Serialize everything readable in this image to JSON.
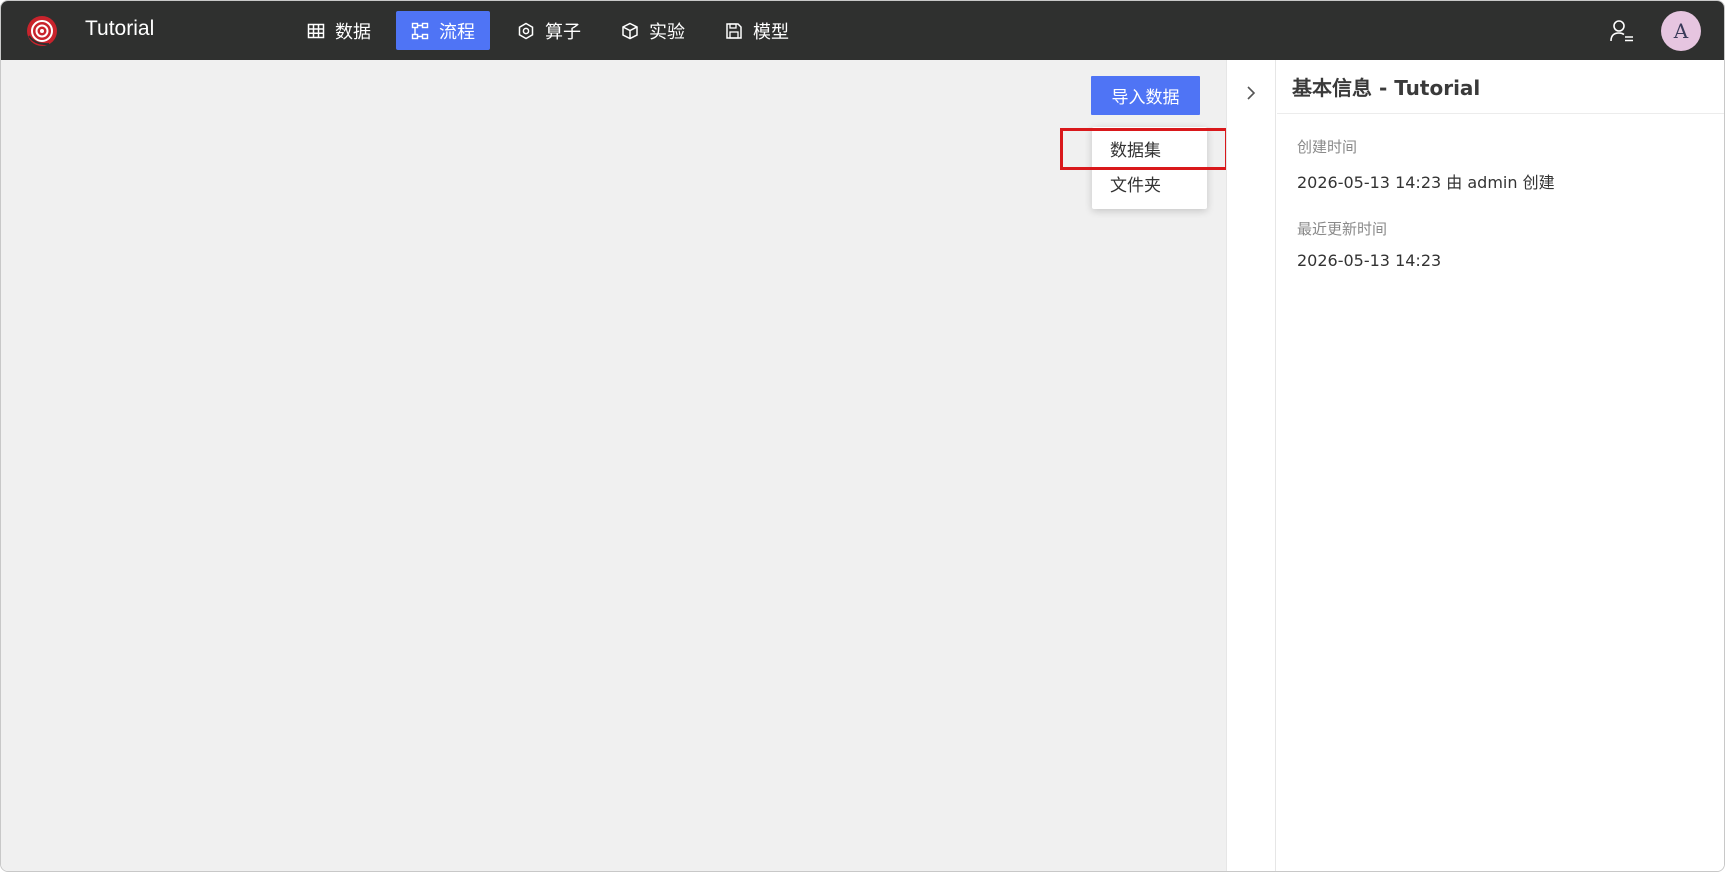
{
  "app": {
    "title": "Tutorial"
  },
  "nav": {
    "tabs": [
      {
        "label": "数据",
        "icon": "table-icon",
        "active": false
      },
      {
        "label": "流程",
        "icon": "flow-icon",
        "active": true
      },
      {
        "label": "算子",
        "icon": "hexagon-icon",
        "active": false
      },
      {
        "label": "实验",
        "icon": "cube-icon",
        "active": false
      },
      {
        "label": "模型",
        "icon": "save-icon",
        "active": false
      }
    ]
  },
  "user": {
    "avatar_initial": "A",
    "menu_icon": "user-list-icon"
  },
  "toolbar": {
    "import_label": "导入数据"
  },
  "dropdown": {
    "items": [
      "数据集",
      "文件夹"
    ]
  },
  "panel": {
    "title": "基本信息 - Tutorial",
    "created_label": "创建时间",
    "created_value": "2026-05-13 14:23  由 admin 创建",
    "updated_label": "最近更新时间",
    "updated_value": "2026-05-13 14:23"
  },
  "colors": {
    "accent": "#4f74f5",
    "topbar": "#2f302f",
    "canvas": "#f0f0f0",
    "highlight": "#d9181b",
    "avatar_bg": "#e6c5e0"
  }
}
